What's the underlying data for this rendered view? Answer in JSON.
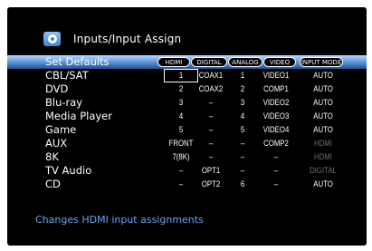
{
  "header": {
    "title": "Inputs/Input Assign",
    "icon": "input-assign-icon"
  },
  "set_defaults": "Set Defaults",
  "columns": [
    "HDMI",
    "DIGITAL",
    "ANALOG",
    "VIDEO",
    "INPUT MODE"
  ],
  "rows": [
    {
      "label": "CBL/SAT",
      "hdmi": "1",
      "digital": "COAX1",
      "analog": "1",
      "video": "VIDEO1",
      "mode": "AUTO",
      "mode_dim": false
    },
    {
      "label": "DVD",
      "hdmi": "2",
      "digital": "COAX2",
      "analog": "2",
      "video": "COMP1",
      "mode": "AUTO",
      "mode_dim": false
    },
    {
      "label": "Blu-ray",
      "hdmi": "3",
      "digital": "–",
      "analog": "3",
      "video": "VIDEO2",
      "mode": "AUTO",
      "mode_dim": false
    },
    {
      "label": "Media Player",
      "hdmi": "4",
      "digital": "–",
      "analog": "4",
      "video": "VIDEO3",
      "mode": "AUTO",
      "mode_dim": false
    },
    {
      "label": "Game",
      "hdmi": "5",
      "digital": "–",
      "analog": "5",
      "video": "VIDEO4",
      "mode": "AUTO",
      "mode_dim": false
    },
    {
      "label": "AUX",
      "hdmi": "FRONT",
      "digital": "–",
      "analog": "–",
      "video": "COMP2",
      "mode": "HDMI",
      "mode_dim": true
    },
    {
      "label": "8K",
      "hdmi": "7(8K)",
      "digital": "–",
      "analog": "–",
      "video": "–",
      "mode": "HDMI",
      "mode_dim": true
    },
    {
      "label": "TV Audio",
      "hdmi": "–",
      "digital": "OPT1",
      "analog": "–",
      "video": "–",
      "mode": "DIGITAL",
      "mode_dim": true
    },
    {
      "label": "CD",
      "hdmi": "–",
      "digital": "OPT2",
      "analog": "6",
      "video": "–",
      "mode": "AUTO",
      "mode_dim": false
    }
  ],
  "footer": "Changes HDMI input assignments",
  "colors": {
    "highlight": "#5a8fd0",
    "footer": "#6aa6ec",
    "dim": "#6e6e6e"
  }
}
